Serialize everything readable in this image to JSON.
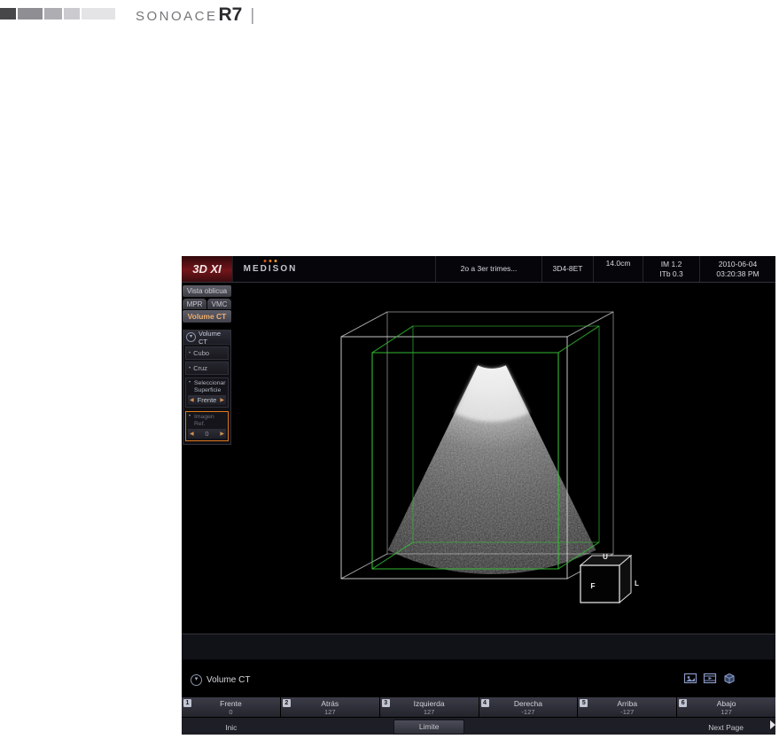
{
  "brand": {
    "name": "SONOACE",
    "model": "R7",
    "divider": "|"
  },
  "app": {
    "topbar": {
      "mode_logo": "3D XI",
      "vendor": "MEDISON",
      "patient": "2o a 3er trimes...",
      "probe": "3D4-8ET",
      "depth": "14.0cm",
      "mi": "IM 1.2",
      "tib": "ITb 0.3",
      "date": "2010-06-04",
      "time": "03:20:38 PM"
    },
    "sidebar": {
      "view_label": "Vista oblicua",
      "tabs": {
        "mpr": "MPR",
        "vmc": "VMC",
        "active": "Volume CT"
      },
      "panel": {
        "title": "Volume CT",
        "cube": "Cubo",
        "cross": "Cruz",
        "surface_line1": "Seleccionar",
        "surface_line2": "Superficie",
        "surface_value": "Frente",
        "ref_label": "Imagen Ref.",
        "ref_value": "0"
      }
    },
    "viewport": {
      "up": "U",
      "front": "F",
      "left": "L"
    },
    "section": {
      "title": "Volume CT"
    },
    "softmenu": {
      "items": [
        {
          "key": "1",
          "label": "Frente",
          "value": "0"
        },
        {
          "key": "2",
          "label": "Atrás",
          "value": "127"
        },
        {
          "key": "3",
          "label": "Izquierda",
          "value": "127"
        },
        {
          "key": "4",
          "label": "Derecha",
          "value": "-127"
        },
        {
          "key": "5",
          "label": "Arriba",
          "value": "-127"
        },
        {
          "key": "6",
          "label": "Abajo",
          "value": "127"
        }
      ],
      "bottom_left": "Inic",
      "bottom_center": "Limite",
      "bottom_right": "Next Page"
    }
  },
  "icons": {
    "collapse": "▾",
    "arrow_left": "◀",
    "arrow_right": "▶",
    "bullet": "•"
  },
  "colors": {
    "accent_orange": "#e07818",
    "roi_green": "#35c235",
    "logo_red": "#73151a"
  }
}
